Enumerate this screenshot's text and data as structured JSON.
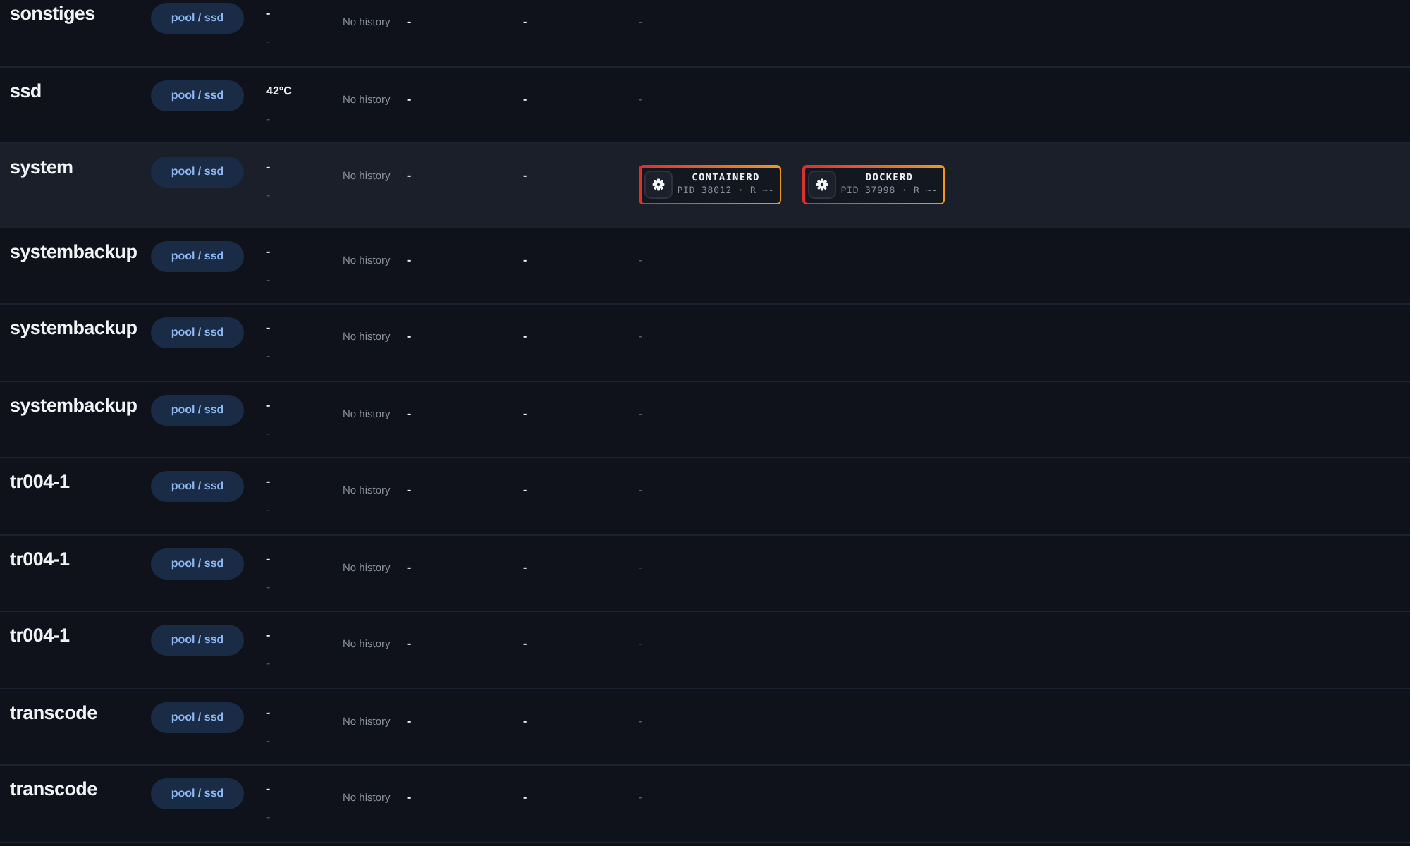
{
  "rows": [
    {
      "name": "sonstiges",
      "selected": false,
      "badge": "pool / ssd",
      "column_3": "-",
      "column_3_sub": "-",
      "history": "No history",
      "column_5": "-",
      "column_6": "-",
      "column_7": "-"
    },
    {
      "name": "ssd",
      "selected": false,
      "badge": "pool / ssd",
      "column_3": "42°C",
      "column_3_sub": "-",
      "history": "No history",
      "column_5": "-",
      "column_6": "-",
      "column_7": "-"
    },
    {
      "name": "system",
      "selected": true,
      "badge": "pool / ssd",
      "column_3": "-",
      "column_3_sub": "-",
      "history": "No history",
      "column_5": "-",
      "column_6": "-",
      "processes": [
        {
          "name": "CONTAINERD",
          "info": "PID 38012 · R ~-"
        },
        {
          "name": "DOCKERD",
          "info": "PID 37998 · R ~-"
        }
      ]
    },
    {
      "name": "systembackup",
      "selected": false,
      "badge": "pool / ssd",
      "column_3": "-",
      "column_3_sub": "-",
      "history": "No history",
      "column_5": "-",
      "column_6": "-",
      "column_7": "-"
    },
    {
      "name": "systembackup",
      "selected": false,
      "badge": "pool / ssd",
      "column_3": "-",
      "column_3_sub": "-",
      "history": "No history",
      "column_5": "-",
      "column_6": "-",
      "column_7": "-"
    },
    {
      "name": "systembackup",
      "selected": false,
      "badge": "pool / ssd",
      "column_3": "-",
      "column_3_sub": "-",
      "history": "No history",
      "column_5": "-",
      "column_6": "-",
      "column_7": "-"
    },
    {
      "name": "tr004-1",
      "selected": false,
      "badge": "pool / ssd",
      "column_3": "-",
      "column_3_sub": "-",
      "history": "No history",
      "column_5": "-",
      "column_6": "-",
      "column_7": "-"
    },
    {
      "name": "tr004-1",
      "selected": false,
      "badge": "pool / ssd",
      "column_3": "-",
      "column_3_sub": "-",
      "history": "No history",
      "column_5": "-",
      "column_6": "-",
      "column_7": "-"
    },
    {
      "name": "tr004-1",
      "selected": false,
      "badge": "pool / ssd",
      "column_3": "-",
      "column_3_sub": "-",
      "history": "No history",
      "column_5": "-",
      "column_6": "-",
      "column_7": "-"
    },
    {
      "name": "transcode",
      "selected": false,
      "badge": "pool / ssd",
      "column_3": "-",
      "column_3_sub": "-",
      "history": "No history",
      "column_5": "-",
      "column_6": "-",
      "column_7": "-"
    },
    {
      "name": "transcode",
      "selected": false,
      "badge": "pool / ssd",
      "column_3": "-",
      "column_3_sub": "-",
      "history": "No history",
      "column_5": "-",
      "column_6": "-",
      "column_7": "-"
    }
  ]
}
